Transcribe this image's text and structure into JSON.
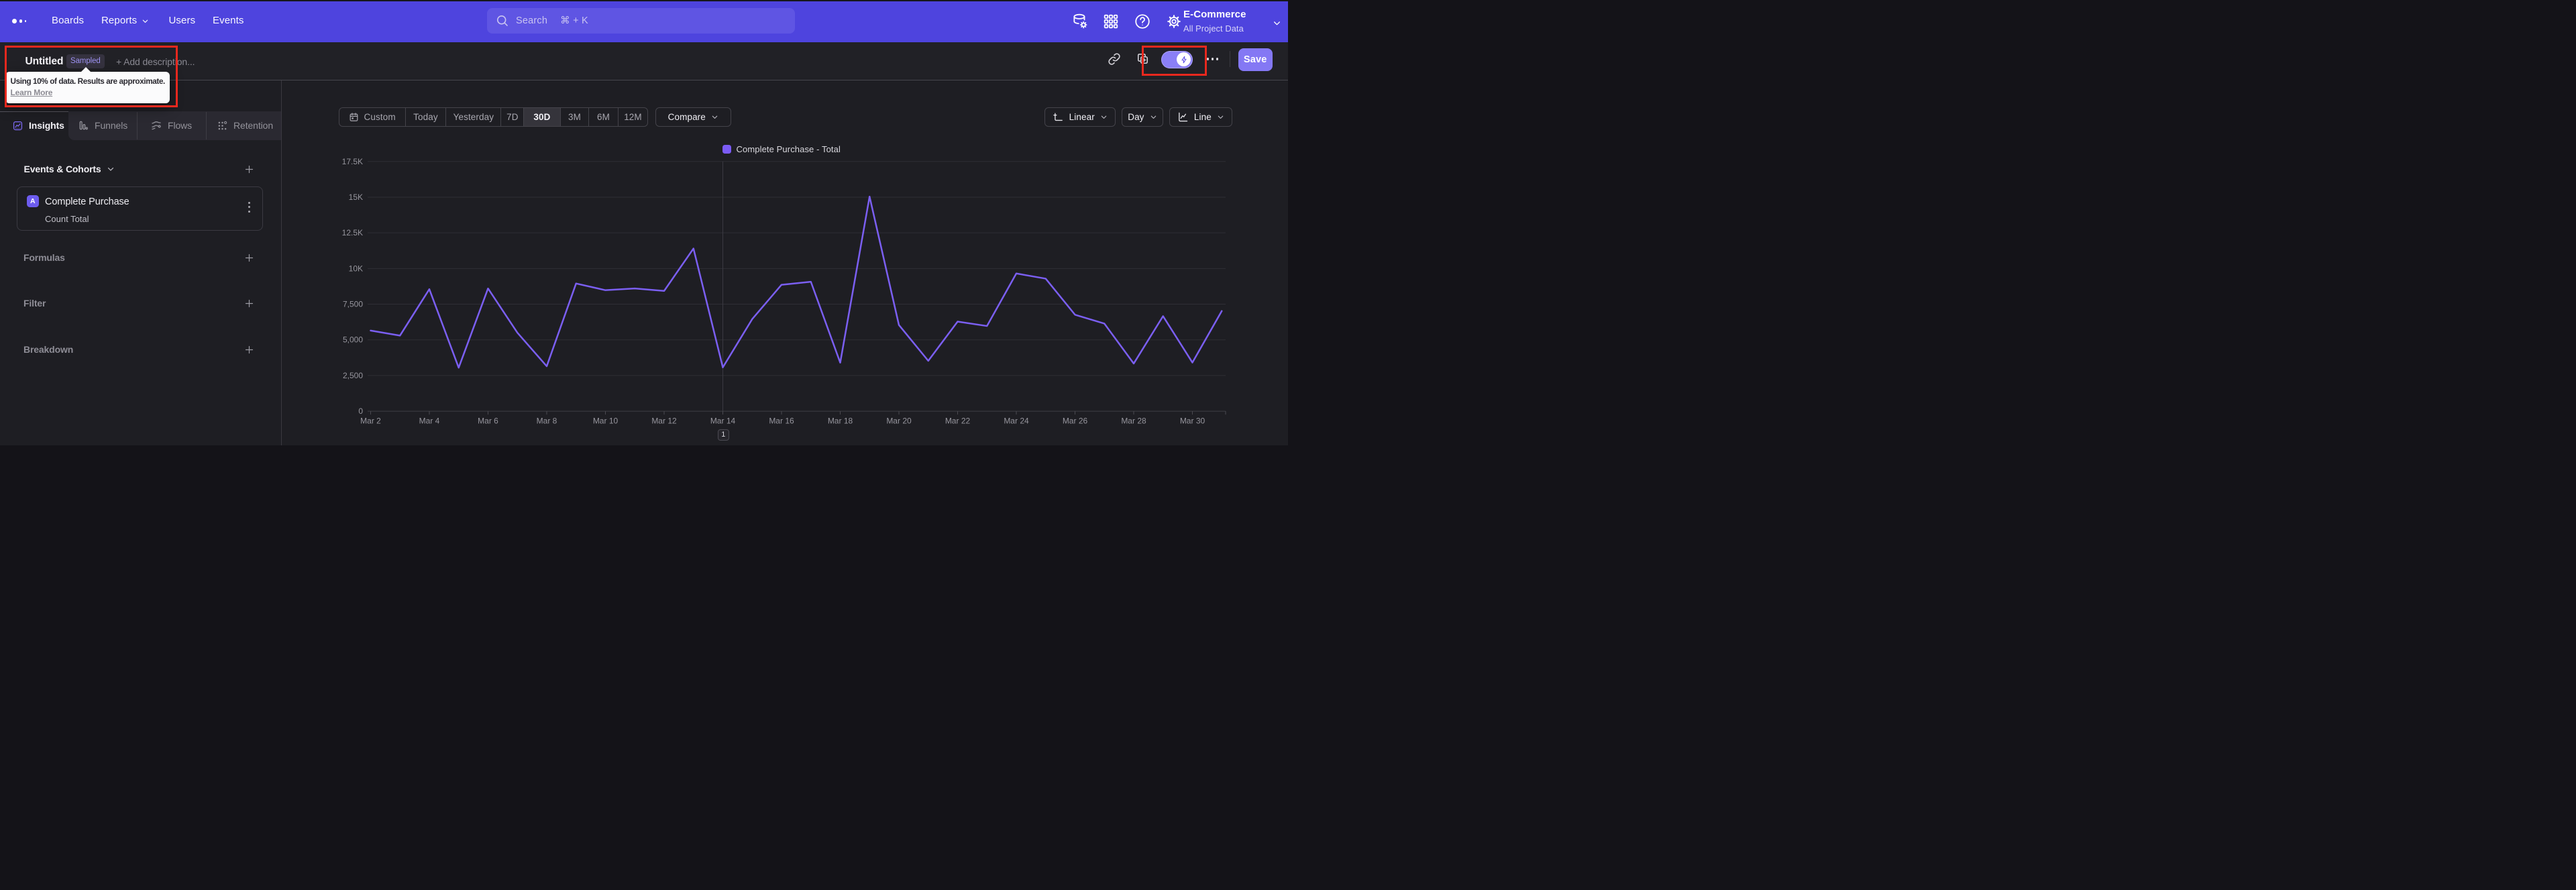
{
  "navbar": {
    "items": [
      {
        "label": "Boards"
      },
      {
        "label": "Reports"
      },
      {
        "label": "Users"
      },
      {
        "label": "Events"
      }
    ],
    "search": {
      "placeholder": "Search",
      "shortcut": "⌘ + K"
    },
    "project": {
      "name": "E-Commerce",
      "scope": "All Project Data"
    },
    "brand_color": "#4E44DE"
  },
  "titlebar": {
    "title": "Untitled",
    "badge": "Sampled",
    "add_description": "+ Add description...",
    "save_label": "Save"
  },
  "tooltip": {
    "text": "Using 10% of data. Results are approximate.",
    "link": "Learn More"
  },
  "panel": {
    "tabs": [
      {
        "label": "Insights"
      },
      {
        "label": "Funnels"
      },
      {
        "label": "Flows"
      },
      {
        "label": "Retention"
      }
    ],
    "events_header": "Events & Cohorts",
    "event": {
      "letter": "A",
      "name": "Complete Purchase",
      "metric": "Count Total"
    },
    "groups": [
      {
        "label": "Formulas"
      },
      {
        "label": "Filter"
      },
      {
        "label": "Breakdown"
      }
    ]
  },
  "toolbar": {
    "ranges": [
      "Custom",
      "Today",
      "Yesterday",
      "7D",
      "30D",
      "3M",
      "6M",
      "12M"
    ],
    "active_range": "30D",
    "compare_label": "Compare",
    "linear_label": "Linear",
    "day_label": "Day",
    "line_label": "Line"
  },
  "pagination": {
    "page": "1"
  },
  "chart_data": {
    "type": "line",
    "title": "",
    "legend": "Complete Purchase - Total",
    "series": [
      {
        "name": "Complete Purchase - Total",
        "color": "#7B5FF2",
        "x": [
          "Mar 2",
          "Mar 3",
          "Mar 4",
          "Mar 5",
          "Mar 6",
          "Mar 7",
          "Mar 8",
          "Mar 9",
          "Mar 10",
          "Mar 11",
          "Mar 12",
          "Mar 13",
          "Mar 14",
          "Mar 15",
          "Mar 16",
          "Mar 17",
          "Mar 18",
          "Mar 19",
          "Mar 20",
          "Mar 21",
          "Mar 22",
          "Mar 23",
          "Mar 24",
          "Mar 25",
          "Mar 26",
          "Mar 27",
          "Mar 28",
          "Mar 29",
          "Mar 30",
          "Mar 31"
        ],
        "values": [
          5650,
          5300,
          8550,
          3050,
          8600,
          5500,
          3150,
          8950,
          8480,
          8600,
          8430,
          11400,
          3070,
          6450,
          8860,
          9070,
          3400,
          15040,
          6040,
          3530,
          6280,
          5970,
          9650,
          9290,
          6760,
          6140,
          3340,
          6660,
          3410,
          7020
        ]
      }
    ],
    "x_tick_labels": [
      "Mar 2",
      "Mar 4",
      "Mar 6",
      "Mar 8",
      "Mar 10",
      "Mar 12",
      "Mar 14",
      "Mar 16",
      "Mar 18",
      "Mar 20",
      "Mar 22",
      "Mar 24",
      "Mar 26",
      "Mar 28",
      "Mar 30"
    ],
    "y_tick_labels": [
      "0",
      "2,500",
      "5,000",
      "7,500",
      "10K",
      "12.5K",
      "15K",
      "17.5K"
    ],
    "y_tick_values": [
      0,
      2500,
      5000,
      7500,
      10000,
      12500,
      15000,
      17500
    ],
    "ylim": [
      0,
      17500
    ],
    "crosshair_index": 12,
    "grid": "horizontal",
    "legend_position": "top-center"
  },
  "colors": {
    "navbar": "#4E44DE",
    "accent": "#8478F4",
    "line": "#7B5FF2",
    "annotation": "#E8281E",
    "background": "#1E1E23"
  }
}
